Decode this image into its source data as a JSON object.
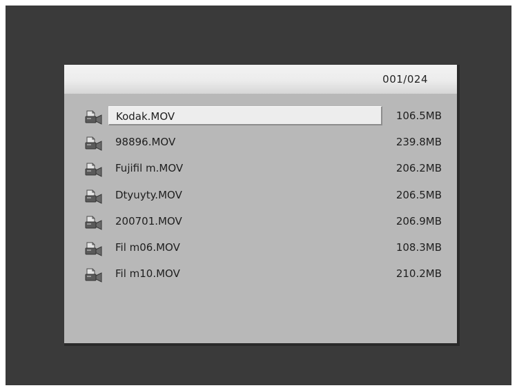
{
  "browser": {
    "counter": "001/024",
    "files": [
      {
        "name": "Kodak.MOV",
        "size": "106.5MB",
        "icon": "video-file-icon",
        "selected": true
      },
      {
        "name": "98896.MOV",
        "size": "239.8MB",
        "icon": "video-file-icon",
        "selected": false
      },
      {
        "name": "Fujifil m.MOV",
        "size": "206.2MB",
        "icon": "video-file-icon",
        "selected": false
      },
      {
        "name": "Dtyuyty.MOV",
        "size": "206.5MB",
        "icon": "video-file-icon",
        "selected": false
      },
      {
        "name": "200701.MOV",
        "size": "206.9MB",
        "icon": "video-file-icon",
        "selected": false
      },
      {
        "name": "Fil m06.MOV",
        "size": "108.3MB",
        "icon": "video-file-icon",
        "selected": false
      },
      {
        "name": "Fil m10.MOV",
        "size": "210.2MB",
        "icon": "video-file-icon",
        "selected": false
      }
    ]
  },
  "colors": {
    "screen_background": "#3a3a3a",
    "panel_background": "#b8b8b8",
    "header_background": "#ececec",
    "selection_background": "#ededed",
    "text": "#1e1e1e"
  }
}
